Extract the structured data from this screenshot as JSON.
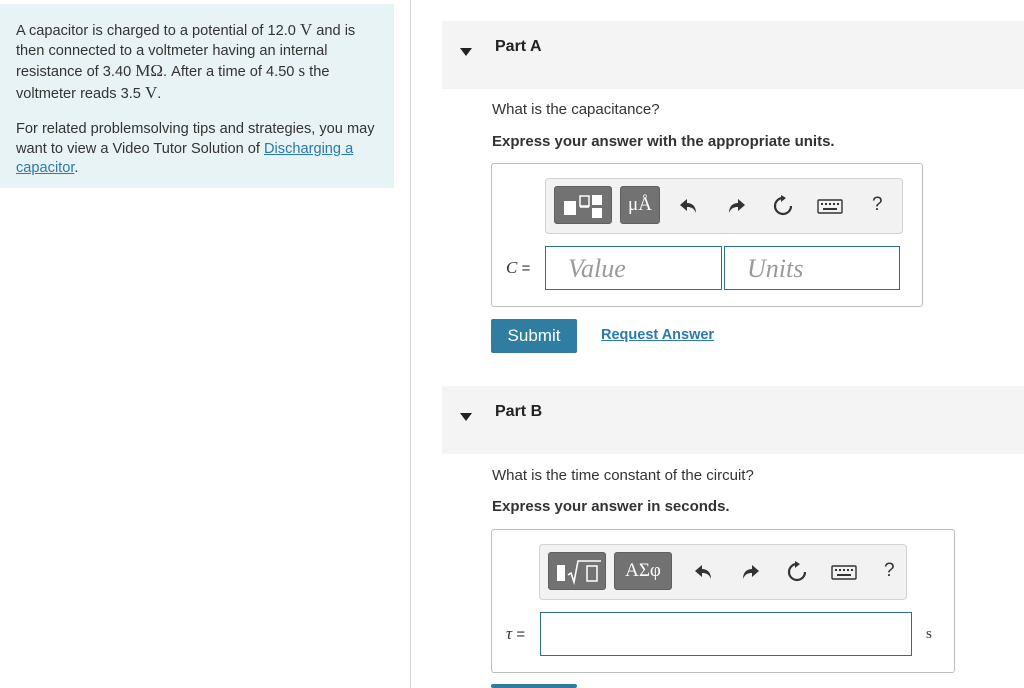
{
  "problem": {
    "text1": "A capacitor is charged to a potential of 12.0 ",
    "v1": "V",
    "text2": " and is then connected to a voltmeter having an internal resistance of 3.40 ",
    "mohm": "MΩ",
    "text3": ". After a time of 4.50 ",
    "s": "s",
    "text4": " the voltmeter reads 3.5 ",
    "v2": "V",
    "text5": ".",
    "tips": "For related problemsolving tips and strategies, you may want to view a Video Tutor Solution of ",
    "link": "Discharging a capacitor",
    "tips_end": "."
  },
  "partA": {
    "title": "Part A",
    "question": "What is the capacitance?",
    "instruction": "Express your answer with the appropriate units.",
    "toolbar": {
      "template_icon": "templates-icon",
      "units_btn": "μÅ",
      "help": "?"
    },
    "variable": "C",
    "equals": "=",
    "value_placeholder": "Value",
    "units_placeholder": "Units",
    "submit": "Submit",
    "request": "Request Answer"
  },
  "partB": {
    "title": "Part B",
    "question": "What is the time constant of the circuit?",
    "instruction": "Express your answer in seconds.",
    "toolbar": {
      "template_icon": "sqrt-template-icon",
      "greek_btn": "ΑΣφ",
      "help": "?"
    },
    "variable": "τ",
    "equals": "=",
    "unit": "s"
  }
}
